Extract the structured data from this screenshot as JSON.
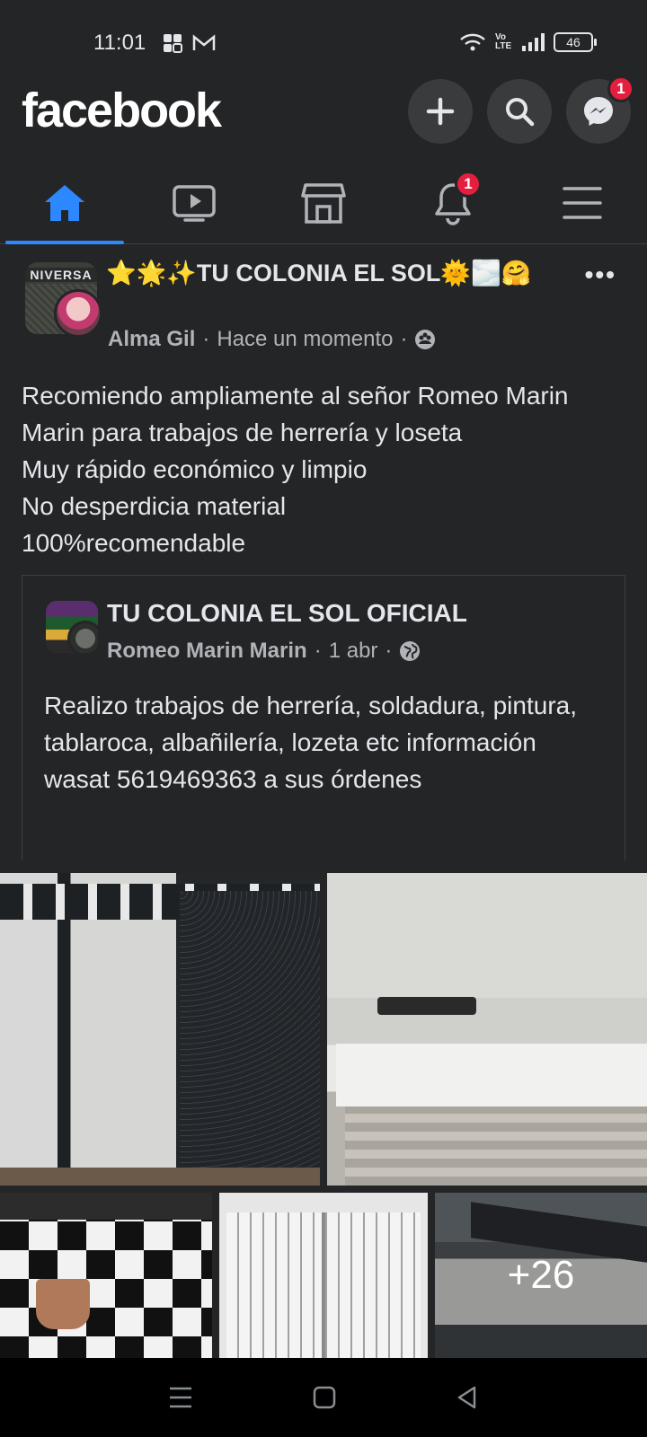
{
  "status_bar": {
    "time": "11:01",
    "battery": "46",
    "network": "Vo LTE"
  },
  "app": {
    "logo": "facebook",
    "brand_color": "#2d88ff",
    "messenger_badge": "1",
    "header_icons": [
      "plus-icon",
      "search-icon",
      "messenger-icon"
    ]
  },
  "nav": {
    "tabs": [
      {
        "name": "home",
        "icon": "home-icon",
        "active": true
      },
      {
        "name": "watch",
        "icon": "video-icon",
        "active": false
      },
      {
        "name": "marketplace",
        "icon": "store-icon",
        "active": false
      },
      {
        "name": "notifications",
        "icon": "bell-icon",
        "active": false,
        "badge": "1"
      },
      {
        "name": "menu",
        "icon": "hamburger-icon",
        "active": false
      }
    ],
    "notifications_badge": "1"
  },
  "post": {
    "group_avatar_text": "NIVERSA",
    "title_emoji_prefix": "⭐🌟✨",
    "title": "TU COLONIA EL SOL",
    "title_emoji_suffix": "🌞🌫️🤗",
    "author": "Alma Gil",
    "time": "Hace un momento",
    "privacy_icon": "group-icon",
    "text_lines": [
      "Recomiendo ampliamente al señor Romeo Marin Marin para trabajos de herrería y loseta",
      "Muy rápido económico y limpio",
      "No desperdicia material",
      "100%recomendable"
    ],
    "shared": {
      "group": "TU COLONIA EL SOL OFICIAL",
      "author": "Romeo Marin Marin",
      "date": "1 abr",
      "privacy_icon": "globe-icon",
      "text": "Realizo trabajos de herrería, soldadura, pintura, tablaroca, albañilería, lozeta etc información wasat 5619469363 a sus órdenes"
    },
    "photos": {
      "extra_count": "+26"
    }
  }
}
